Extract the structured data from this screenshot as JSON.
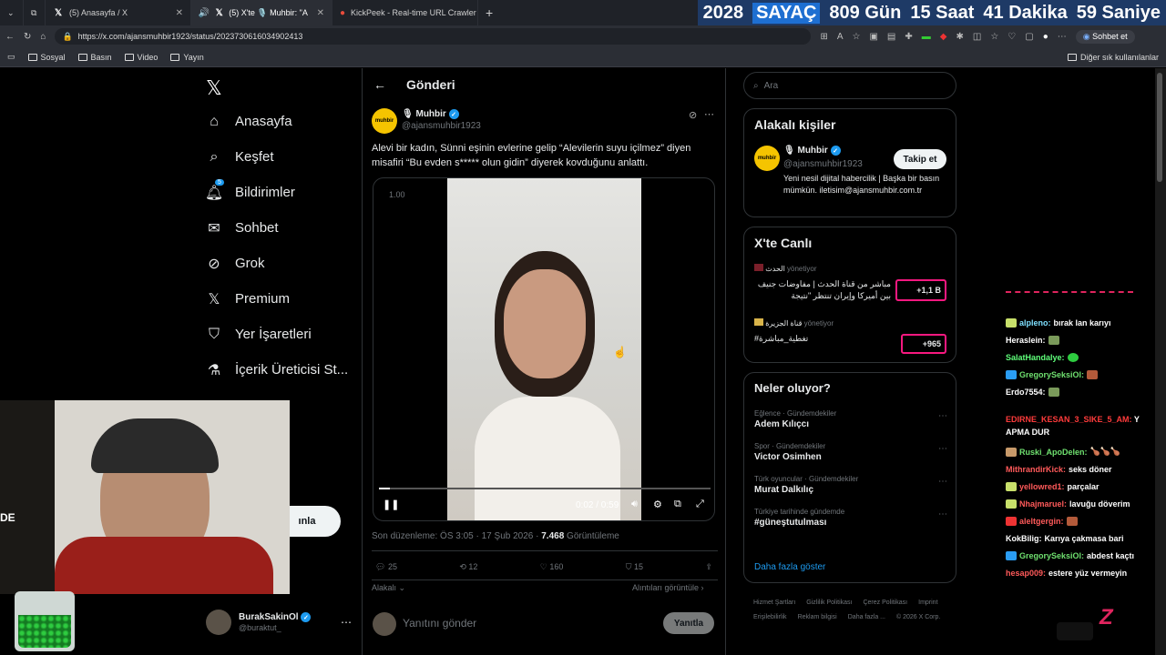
{
  "browser": {
    "tabs": [
      {
        "label": "(5) Anasayfa / X"
      },
      {
        "label": "(5) X'te 🎙️ Muhbir: \"Alevi bir"
      },
      {
        "label": "KickPeek - Real-time URL Crawler"
      }
    ],
    "url": "https://x.com/ajansmuhbir1923/status/2023730616034902413",
    "profile_button": "Sohbet et",
    "bookmarks": [
      "Sosyal",
      "Basın",
      "Video",
      "Yayın"
    ],
    "other_bookmarks": "Diğer sık kullanılanlar"
  },
  "counter": {
    "year": "2028",
    "label": "SAYAÇ",
    "days": "809 Gün",
    "hours": "15 Saat",
    "minutes": "41 Dakika",
    "seconds": "59 Saniye"
  },
  "sidebar": {
    "items": [
      {
        "label": "Anasayfa",
        "icon": "home-icon"
      },
      {
        "label": "Keşfet",
        "icon": "search-icon"
      },
      {
        "label": "Bildirimler",
        "icon": "bell-icon",
        "badge": "5"
      },
      {
        "label": "Sohbet",
        "icon": "mail-icon"
      },
      {
        "label": "Grok",
        "icon": "grok-icon"
      },
      {
        "label": "Premium",
        "icon": "x-icon"
      },
      {
        "label": "Yer İşaretleri",
        "icon": "bookmark-icon"
      },
      {
        "label": "İçerik Üreticisi St...",
        "icon": "flask-icon"
      }
    ],
    "post_button_partial": "ınla",
    "account": {
      "name": "BurakSakinOl",
      "handle": "@buraktut_"
    }
  },
  "post": {
    "header": "Gönderi",
    "author_name": "Muhbir",
    "author_handle": "@ajansmuhbir1923",
    "avatar_text": "muhbir",
    "text": "Alevi bir kadın, Sünni eşinin evlerine gelip “Alevilerin suyu içilmez” diyen misafiri “Bu evden s***** olun gidin” diyerek kovduğunu anlattı.",
    "video": {
      "rate": "1.00",
      "time": "0:02 / 0:59",
      "progress": 0.034
    },
    "meta_prefix": "Son düzenleme: ÖS 3:05 · 17 Şub 2026 · ",
    "views": "7.468",
    "views_label": " Görüntüleme",
    "actions": {
      "replies": "25",
      "reposts": "12",
      "likes": "160",
      "bookmarks": "15"
    },
    "quotes_left": "Alakalı",
    "quotes_right": "Alıntıları görüntüle ›",
    "reply_placeholder": "Yanıtını gönder",
    "reply_button": "Yanıtla"
  },
  "right": {
    "search_placeholder": "Ara",
    "related_title": "Alakalı kişiler",
    "related": {
      "name": "Muhbir",
      "handle": "@ajansmuhbir1923",
      "follow": "Takip et",
      "bio": "Yeni nesil dijital habercilik | Başka bir basın mümkün. iletisim@ajansmuhbir.com.tr"
    },
    "live_title": "X'te Canlı",
    "live": [
      {
        "channel": "الحدث",
        "role": "yönetiyor",
        "title": "مباشر من قناة الحدث | مفاوضات جنيف بين أميركا وإيران تنتظر \"نتيجة",
        "count": "+1,1 B"
      },
      {
        "channel": "قناة الجزيرة",
        "role": "yönetiyor",
        "title": "#تغطية_مباشرة",
        "count": "+965"
      }
    ],
    "trends_title": "Neler oluyor?",
    "trends": [
      {
        "cat": "Eğlence · Gündemdekiler",
        "name": "Adem Kılıçcı"
      },
      {
        "cat": "Spor · Gündemdekiler",
        "name": "Victor Osimhen"
      },
      {
        "cat": "Türk oyuncular · Gündemdekiler",
        "name": "Murat Dalkılıç"
      },
      {
        "cat": "Türkiye tarihinde gündemde",
        "name": "#güneştutulması"
      }
    ],
    "show_more": "Daha fazla göster",
    "footer": [
      "Hizmet Şartları",
      "Gizlilik Politikası",
      "Çerez Politikası",
      "Imprint",
      "Erişilebilirlik",
      "Reklam bilgisi",
      "Daha fazla ...",
      "© 2026 X Corp."
    ]
  },
  "chat": {
    "lines": [
      {
        "user": "alpleno:",
        "msg": "bırak lan karıyı",
        "color": "#7ee0ff"
      },
      {
        "user": "Heraslein:",
        "msg": "",
        "color": "#ffffff"
      },
      {
        "user": "SalatHandalye:",
        "msg": "",
        "color": "#5fff7a"
      },
      {
        "user": "GregorySeksiOl:",
        "msg": "",
        "color": "#6fe06f"
      },
      {
        "user": "Erdo7554:",
        "msg": "",
        "color": "#ffffff"
      },
      {
        "user": "EDIRNE_KESAN_3_SIKE_5_AM:",
        "msg": "Y APMA DUR",
        "color": "#ff3b3b"
      },
      {
        "user": "Ruski_ApoDelen:",
        "msg": "",
        "color": "#6fe06f"
      },
      {
        "user": "MithrandirKick:",
        "msg": "seks döner",
        "color": "#ff5a5a"
      },
      {
        "user": "yellowred1:",
        "msg": "parçalar",
        "color": "#ff5a5a"
      },
      {
        "user": "Nhajmaruel:",
        "msg": "lavuğu döverim",
        "color": "#ff5a5a"
      },
      {
        "user": "aleltgergin:",
        "msg": "",
        "color": "#ff5a5a"
      },
      {
        "user": "KokBilig:",
        "msg": "Karıya çakmasa bari",
        "color": "#ffffff"
      },
      {
        "user": "GregorySeksiOl:",
        "msg": "abdest kaçtı",
        "color": "#6fe06f"
      },
      {
        "user": "hesap009:",
        "msg": "estere yüz vermeyin",
        "color": "#ff5a5a"
      }
    ]
  },
  "webcam": {
    "overlay_text": "DE"
  }
}
